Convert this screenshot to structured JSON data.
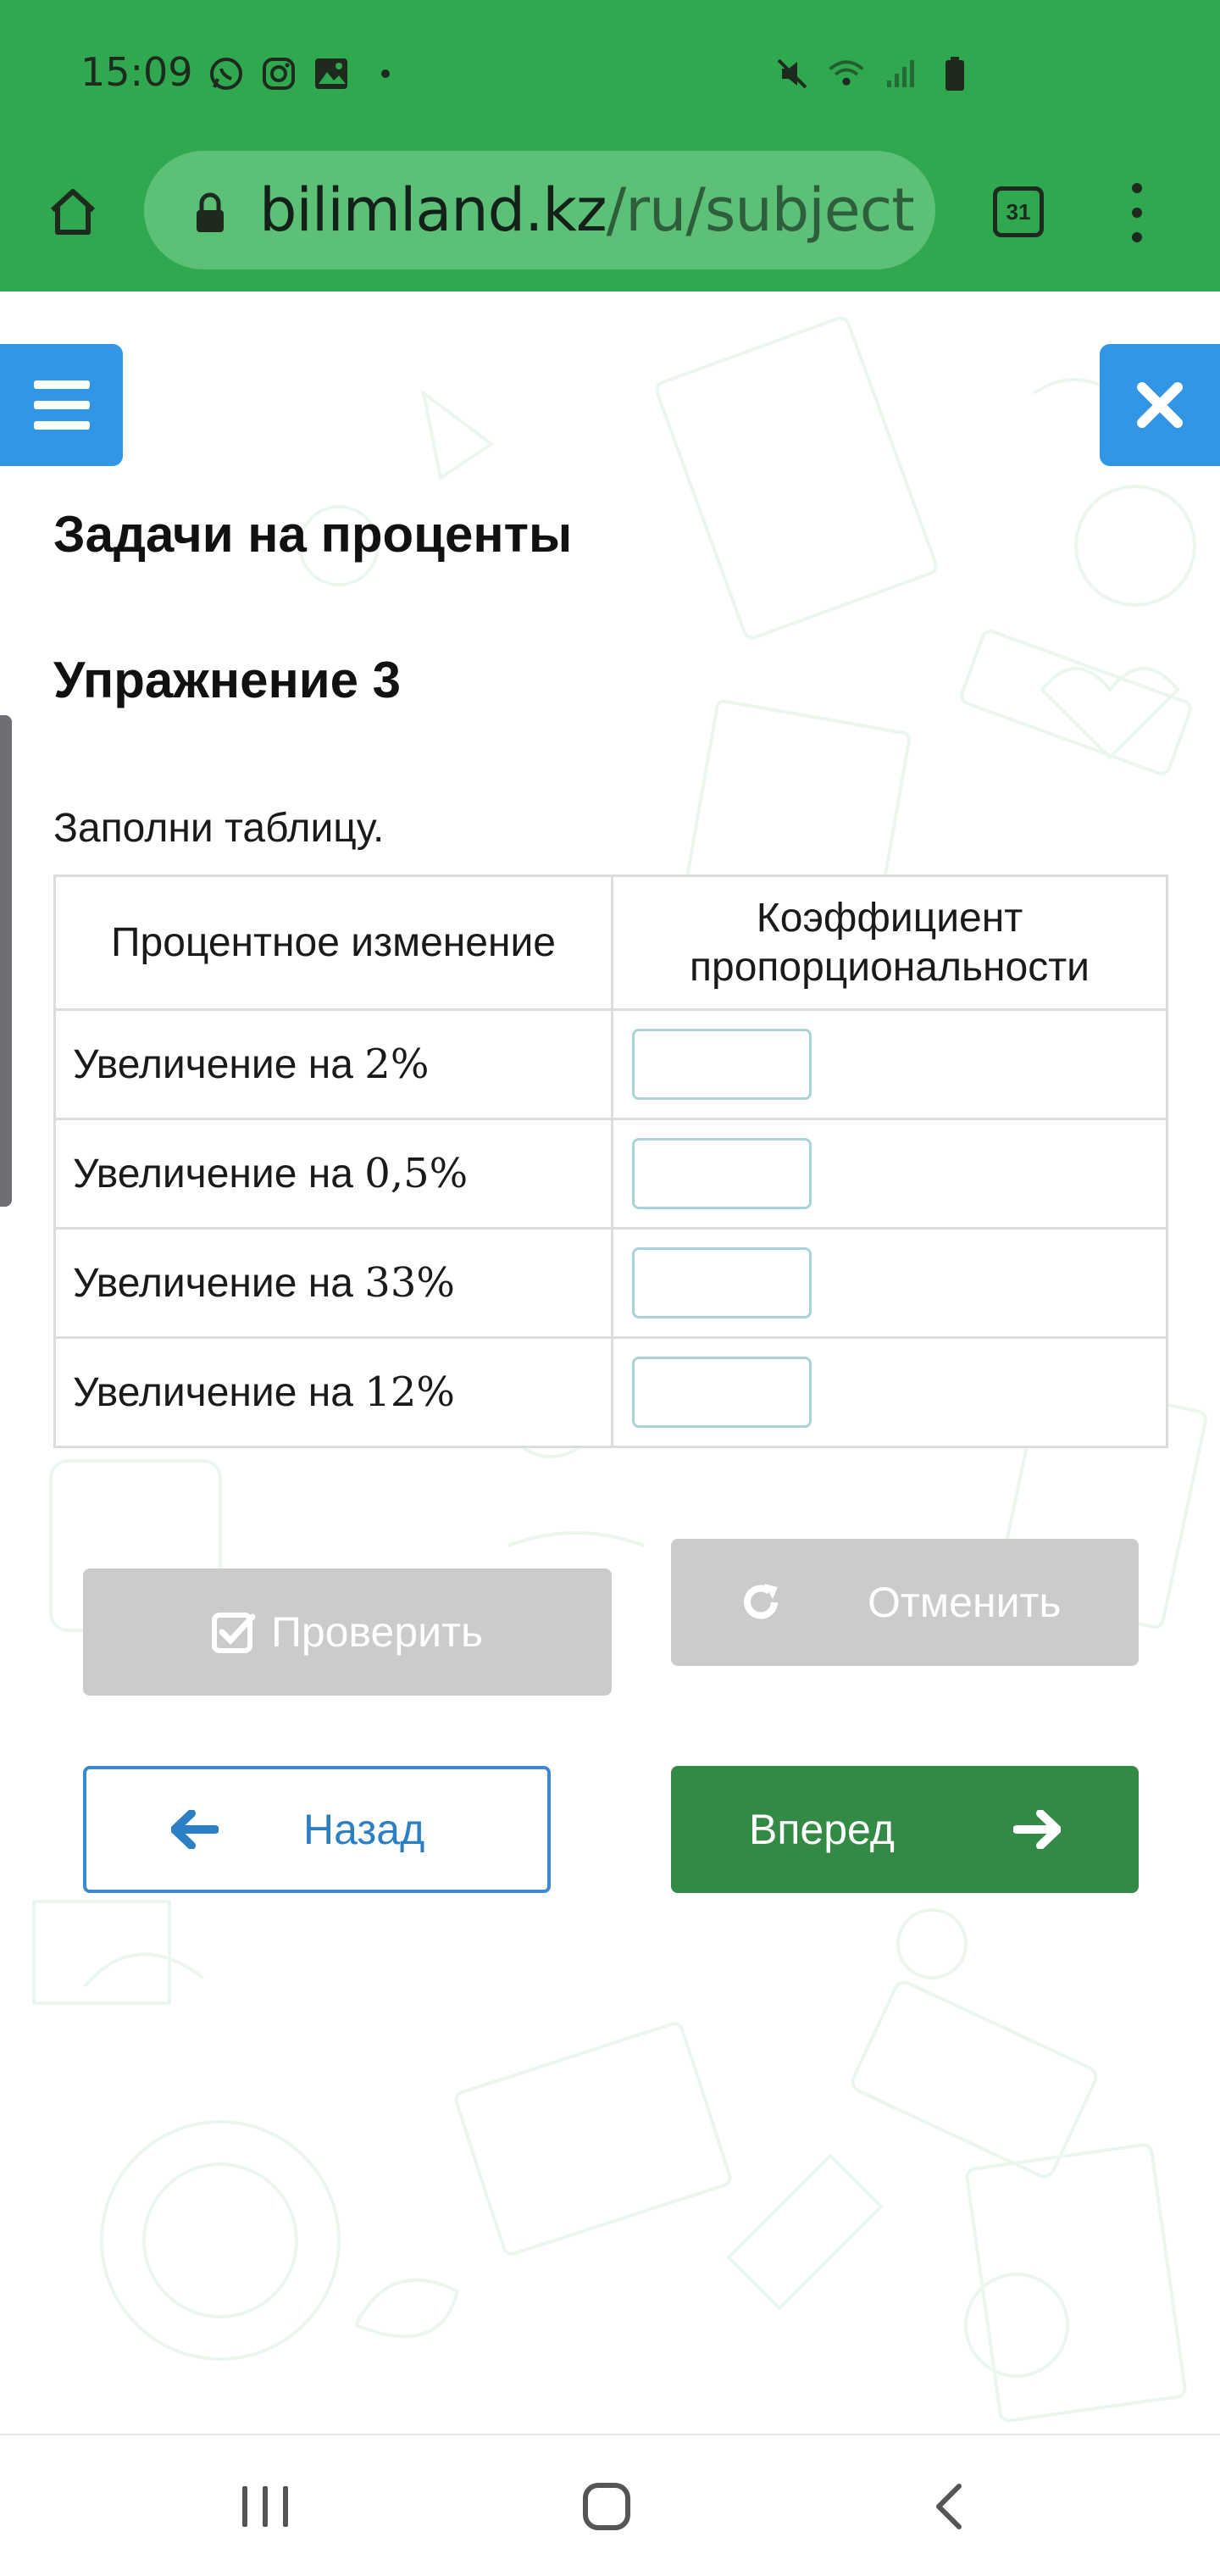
{
  "status_bar": {
    "time": "15:09"
  },
  "browser": {
    "url_domain": "bilimland.kz",
    "url_path": "/ru/subject",
    "tab_count": "31"
  },
  "page": {
    "topic_title": "Задачи на проценты",
    "exercise_title": "Упражнение 3",
    "instruction": "Заполни таблицу.",
    "table": {
      "headers": [
        "Процентное изменение",
        "Коэффициент пропорциональности"
      ],
      "rows": [
        {
          "label": "Увеличение на ",
          "value": "2%",
          "answer": ""
        },
        {
          "label": "Увеличение на ",
          "value": "0,5%",
          "answer": ""
        },
        {
          "label": "Увеличение на ",
          "value": "33%",
          "answer": ""
        },
        {
          "label": "Увеличение на ",
          "value": "12%",
          "answer": ""
        }
      ]
    },
    "buttons": {
      "check": "Проверить",
      "cancel": "Отменить",
      "back": "Назад",
      "forward": "Вперед"
    }
  },
  "colors": {
    "browser_bar": "#2fa84f",
    "accent_blue": "#3196e6",
    "forward_green": "#328a44",
    "disabled_gray": "#cbcbcb"
  }
}
